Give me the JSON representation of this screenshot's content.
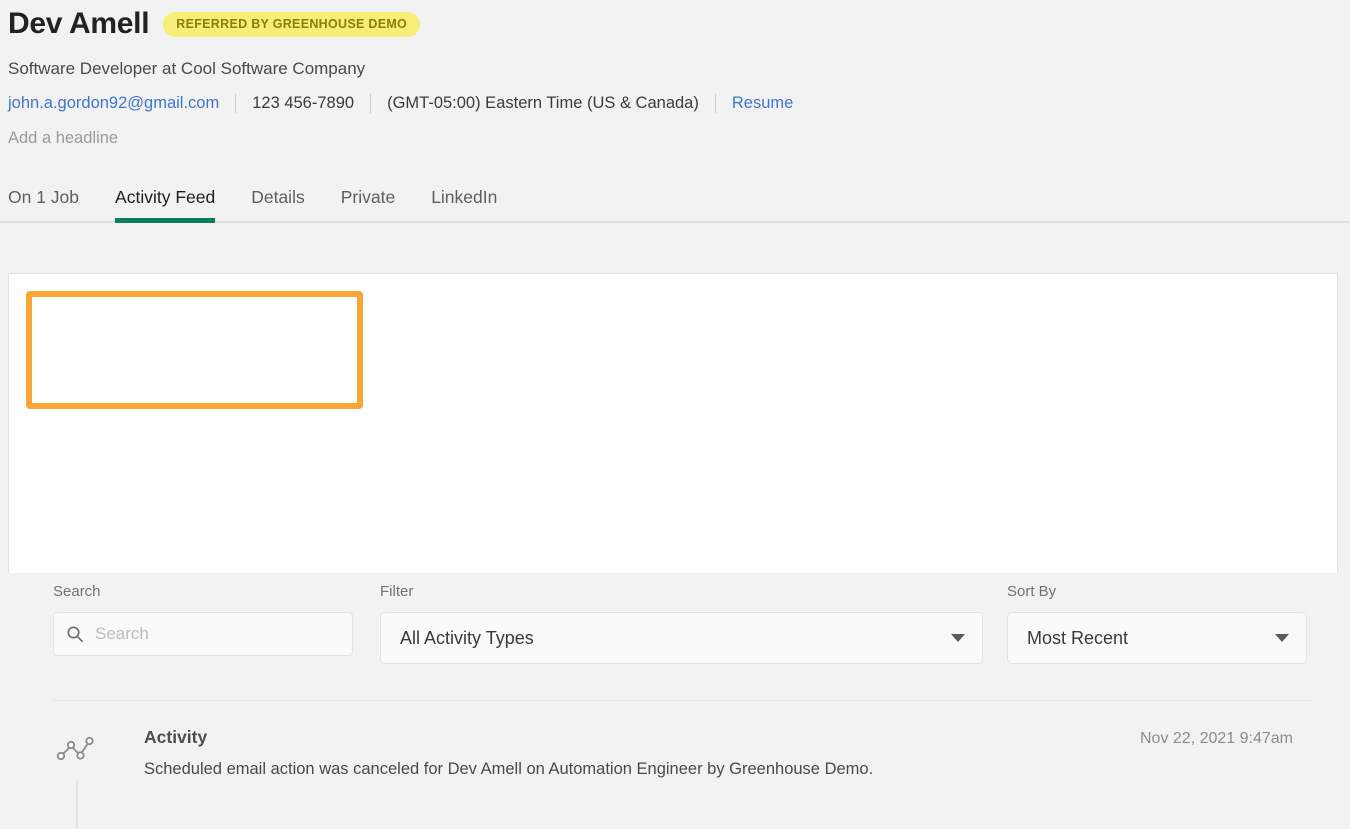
{
  "header": {
    "candidate_name": "Dev Amell",
    "referral_badge": "REFERRED BY GREENHOUSE DEMO",
    "headline_title": "Software Developer at Cool Software Company",
    "email": "john.a.gordon92@gmail.com",
    "phone": "123 456-7890",
    "timezone": "(GMT-05:00) Eastern Time (US & Canada)",
    "resume_link": "Resume",
    "add_headline_placeholder": "Add a headline"
  },
  "tabs": [
    {
      "label": "On 1 Job",
      "active": false
    },
    {
      "label": "Activity Feed",
      "active": true
    },
    {
      "label": "Details",
      "active": false
    },
    {
      "label": "Private",
      "active": false
    },
    {
      "label": "LinkedIn",
      "active": false
    }
  ],
  "filters": {
    "search_label": "Search",
    "search_value": "",
    "search_placeholder": "Search",
    "filter_label": "Filter",
    "filter_value": "All Activity Types",
    "sort_label": "Sort By",
    "sort_value": "Most Recent"
  },
  "activities": [
    {
      "icon": "activity-line-chart-icon",
      "title": "Activity",
      "timestamp": "Nov 22, 2021 9:47am",
      "description": "Scheduled email action was canceled for Dev Amell on Automation Engineer by Greenhouse Demo."
    }
  ],
  "colors": {
    "accent_green": "#0a7e61",
    "link_blue": "#3f76d6",
    "badge_bg": "#f6ee79",
    "badge_text": "#8f7c0e",
    "highlight_orange": "#faa634",
    "page_bg": "#f2f2f2"
  }
}
